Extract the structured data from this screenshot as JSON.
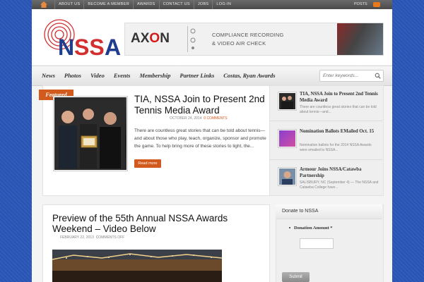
{
  "topbar": {
    "links": [
      "ABOUT US",
      "BECOME A MEMBER",
      "AWARDS",
      "CONTACT US",
      "JOBS",
      "LOG-IN"
    ],
    "posts_label": "POSTS"
  },
  "logo": {
    "text": "NSSA",
    "colors": {
      "N": "#1f3d8f",
      "SS": "#d32f2f",
      "A": "#1f3d8f"
    }
  },
  "ad": {
    "logo_left": "AX",
    "logo_o": "O",
    "logo_right": "N",
    "line1": "COMPLIANCE RECORDING",
    "line2": "& VIDEO AIR CHECK"
  },
  "nav": {
    "items": [
      "News",
      "Photos",
      "Video",
      "Events",
      "Membership",
      "Partner Links",
      "Costas, Ryan Awards"
    ],
    "search_placeholder": "Enter keywords..."
  },
  "featured": {
    "badge": "Featured",
    "title": "TIA, NSSA Join to Present 2nd Tennis Media Award",
    "date": "OCTOBER 24, 2014",
    "comments": "0 COMMENTS",
    "excerpt": "There are countless great stories that can be told about tennis—and about those who play, teach, organize, sponsor and promote the game. To help bring more of these stories to light, the...",
    "read_more": "Read more"
  },
  "side_posts": [
    {
      "title": "TIA, NSSA Join to Present 2nd Tennis Media Award",
      "excerpt": "There are countless great stories that can be told about tennis—and..."
    },
    {
      "title": "Nomination Ballots EMailed Oct. 15",
      "excerpt": "Nomination ballots for the 2014 NSSA Awards were emailed to NSSA..."
    },
    {
      "title": "Armour Joins NSSA/Catawba Partnership",
      "excerpt": "SALISBURY, NC (September 4) — The NSSA and Catawba College have..."
    }
  ],
  "post2": {
    "title": "Preview of the 55th Annual NSSA Awards Weekend – Video Below",
    "date": "FEBRUARY 22, 2013",
    "comments": "COMMENTS OFF"
  },
  "donate": {
    "title": "Donate to NSSA",
    "label": "Donation Amount *",
    "button": "Submit"
  },
  "colors": {
    "accent": "#d25a1c",
    "background": "#2a56b8"
  }
}
